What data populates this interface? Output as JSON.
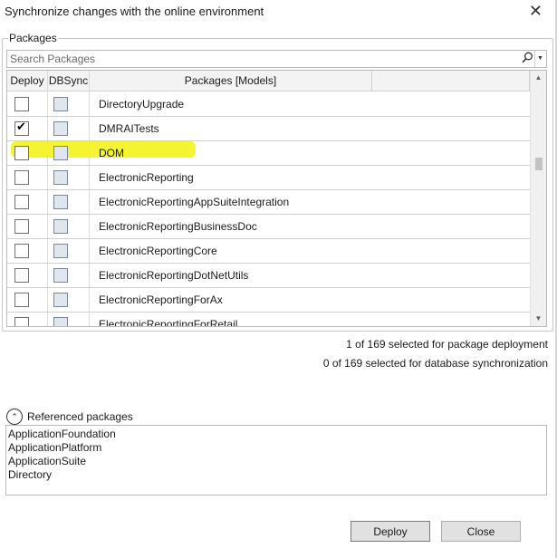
{
  "window": {
    "title": "Synchronize changes with the online environment",
    "close_glyph": "✕"
  },
  "packages_group": {
    "label": "Packages"
  },
  "search": {
    "placeholder": "Search Packages",
    "icon": "search-icon",
    "dropdown_glyph": "▼"
  },
  "table": {
    "columns": [
      "Deploy",
      "DBSync",
      "Packages [Models]",
      ""
    ],
    "rows": [
      {
        "name": "DirectoryUpgrade",
        "deploy": false,
        "dbsync": false
      },
      {
        "name": "DMRAITests",
        "deploy": true,
        "dbsync": false
      },
      {
        "name": "DOM",
        "deploy": false,
        "dbsync": false
      },
      {
        "name": "ElectronicReporting",
        "deploy": false,
        "dbsync": false
      },
      {
        "name": "ElectronicReportingAppSuiteIntegration",
        "deploy": false,
        "dbsync": false
      },
      {
        "name": "ElectronicReportingBusinessDoc",
        "deploy": false,
        "dbsync": false
      },
      {
        "name": "ElectronicReportingCore",
        "deploy": false,
        "dbsync": false
      },
      {
        "name": "ElectronicReportingDotNetUtils",
        "deploy": false,
        "dbsync": false
      },
      {
        "name": "ElectronicReportingForAx",
        "deploy": false,
        "dbsync": false
      },
      {
        "name": "ElectronicReportingForRetail",
        "deploy": false,
        "dbsync": false
      }
    ],
    "highlight_color": "#f3f31a"
  },
  "status": {
    "deployment": "1 of 169 selected for package deployment",
    "dbsync": "0 of 169 selected for database synchronization"
  },
  "referenced": {
    "label": "Referenced packages",
    "toggle_glyph": "⌃",
    "items": [
      "ApplicationFoundation",
      "ApplicationPlatform",
      "ApplicationSuite",
      "Directory"
    ]
  },
  "buttons": {
    "deploy": "Deploy",
    "close": "Close"
  }
}
